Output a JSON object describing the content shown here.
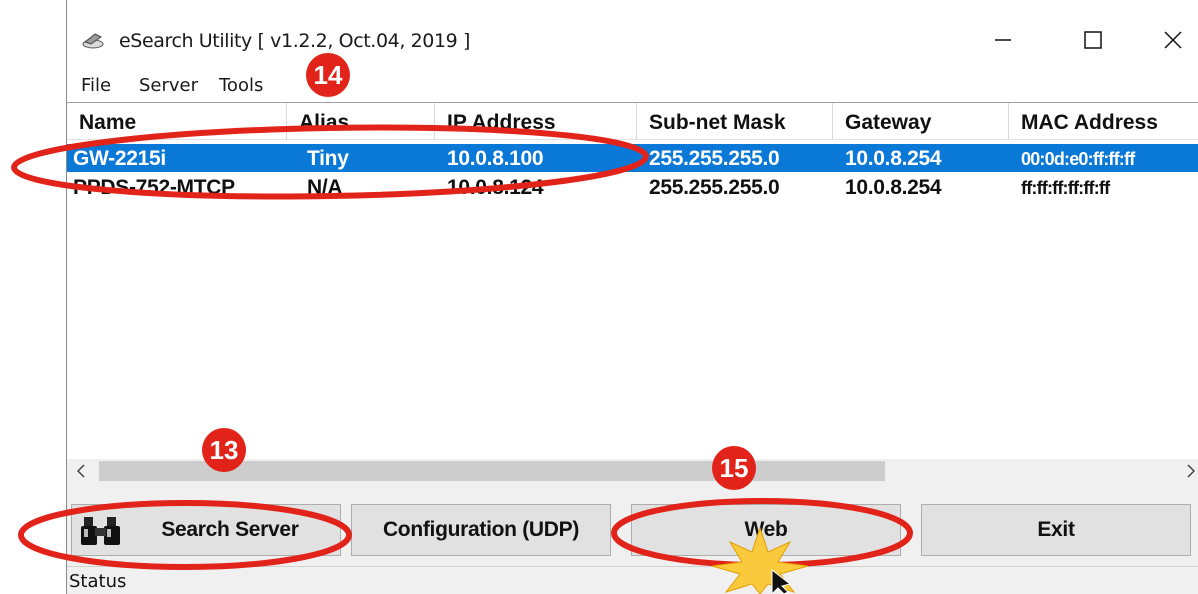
{
  "window": {
    "title": "eSearch Utility [ v1.2.2, Oct.04, 2019 ]",
    "app_icon": "network-tool-icon"
  },
  "menu": [
    "File",
    "Server",
    "Tools"
  ],
  "columns": [
    "Name",
    "Alias",
    "IP Address",
    "Sub-net Mask",
    "Gateway",
    "MAC Address"
  ],
  "rows": [
    {
      "name": "GW-2215i",
      "alias": "Tiny",
      "ip": "10.0.8.100",
      "mask": "255.255.255.0",
      "gateway": "10.0.8.254",
      "mac": "00:0d:e0:ff:ff:ff",
      "selected": true
    },
    {
      "name": "PPDS-752-MTCP",
      "alias": "N/A",
      "ip": "10.0.8.124",
      "mask": "255.255.255.0",
      "gateway": "10.0.8.254",
      "mac": "ff:ff:ff:ff:ff:ff",
      "selected": false
    }
  ],
  "buttons": {
    "search": "Search Server",
    "config": "Configuration (UDP)",
    "web": "Web",
    "exit": "Exit"
  },
  "status": "Status",
  "steps": {
    "search": "13",
    "row": "14",
    "web": "15"
  },
  "colors": {
    "selection": "#0a78d7",
    "annotation": "#e2231a"
  }
}
